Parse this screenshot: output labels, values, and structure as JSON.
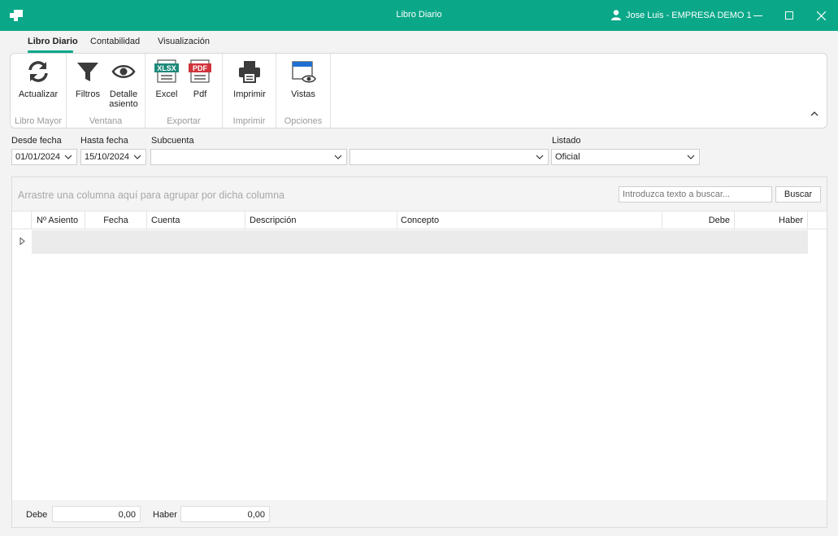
{
  "window": {
    "title": "Libro Diario",
    "user": "Jose Luis - EMPRESA DEMO 1"
  },
  "tabs": [
    {
      "label": "Libro Diario"
    },
    {
      "label": "Contabilidad"
    },
    {
      "label": "Visualización"
    }
  ],
  "ribbon": {
    "groups": [
      {
        "label": "Libro Mayor",
        "buttons": [
          {
            "label": "Actualizar",
            "icon": "refresh-icon"
          }
        ]
      },
      {
        "label": "Ventana",
        "buttons": [
          {
            "label": "Filtros",
            "icon": "filter-icon"
          },
          {
            "label": "Detalle",
            "label2": "asiento",
            "icon": "eye-icon"
          }
        ]
      },
      {
        "label": "Exportar",
        "buttons": [
          {
            "label": "Excel",
            "icon": "xlsx-icon",
            "badge": "XLSX"
          },
          {
            "label": "Pdf",
            "icon": "pdf-icon",
            "badge": "PDF"
          }
        ]
      },
      {
        "label": "Imprimir",
        "buttons": [
          {
            "label": "Imprimir",
            "icon": "printer-icon"
          }
        ]
      },
      {
        "label": "Opciones",
        "buttons": [
          {
            "label": "Vistas",
            "icon": "views-icon"
          }
        ]
      }
    ]
  },
  "filters": {
    "desde": {
      "label": "Desde fecha",
      "value": "01/01/2024"
    },
    "hasta": {
      "label": "Hasta fecha",
      "value": "15/10/2024"
    },
    "subcuenta": {
      "label": "Subcuenta",
      "value": "",
      "value2": ""
    },
    "listado": {
      "label": "Listado",
      "value": "Oficial"
    }
  },
  "grid": {
    "group_hint": "Arrastre una columna aquí para agrupar por dicha columna",
    "search_placeholder": "Introduzca texto a buscar...",
    "search_button": "Buscar",
    "columns": [
      "Nº Asiento",
      "Fecha",
      "Cuenta",
      "Descripción",
      "Concepto",
      "Debe",
      "Haber"
    ]
  },
  "totals": {
    "debe_label": "Debe",
    "debe_value": "0,00",
    "haber_label": "Haber",
    "haber_value": "0,00"
  },
  "colors": {
    "accent": "#0aa889",
    "xlsx": "#1d8a7a",
    "pdf": "#d0343c",
    "views": "#1f6fd1"
  }
}
